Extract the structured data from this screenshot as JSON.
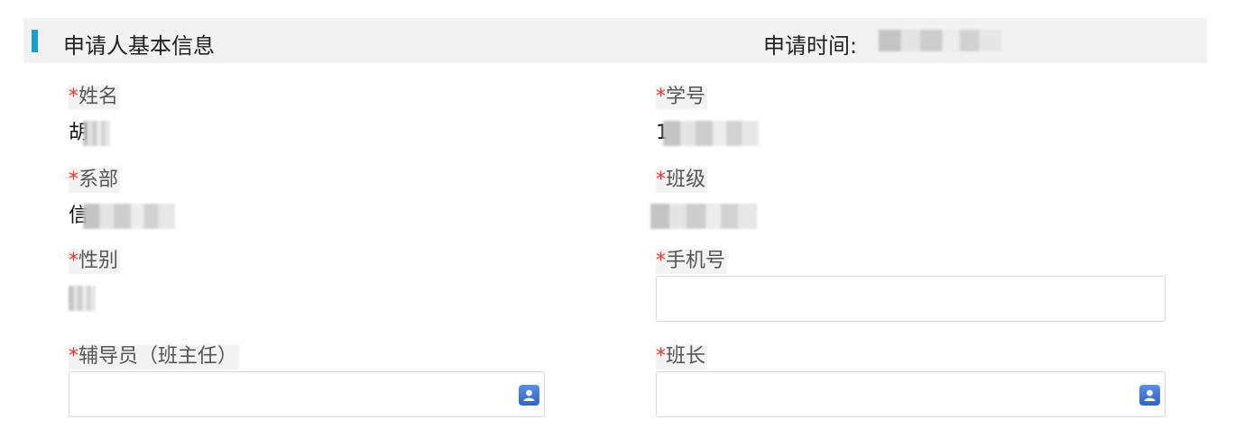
{
  "section": {
    "title": "申请人基本信息",
    "apply_time_label": "申请时间:",
    "apply_time_value": ""
  },
  "fields": {
    "name": {
      "required": "*",
      "label": "姓名",
      "value_visible": "胡"
    },
    "student_id": {
      "required": "*",
      "label": "学号",
      "value_visible": "1"
    },
    "department": {
      "required": "*",
      "label": "系部",
      "value_visible": "信"
    },
    "class": {
      "required": "*",
      "label": "班级",
      "value_visible": ""
    },
    "gender": {
      "required": "*",
      "label": "性别",
      "value_visible": ""
    },
    "phone": {
      "required": "*",
      "label": "手机号",
      "value": "",
      "placeholder": ""
    },
    "counselor": {
      "required": "*",
      "label": "辅导员（班主任）",
      "value": "",
      "icon": "user-picker-icon"
    },
    "monitor": {
      "required": "*",
      "label": "班长",
      "value": "",
      "icon": "user-picker-icon"
    }
  },
  "colors": {
    "accent": "#1aa0c8",
    "required": "#ee3333",
    "header_bg": "#f2f2f2",
    "picker_icon": "#3a70d4"
  }
}
